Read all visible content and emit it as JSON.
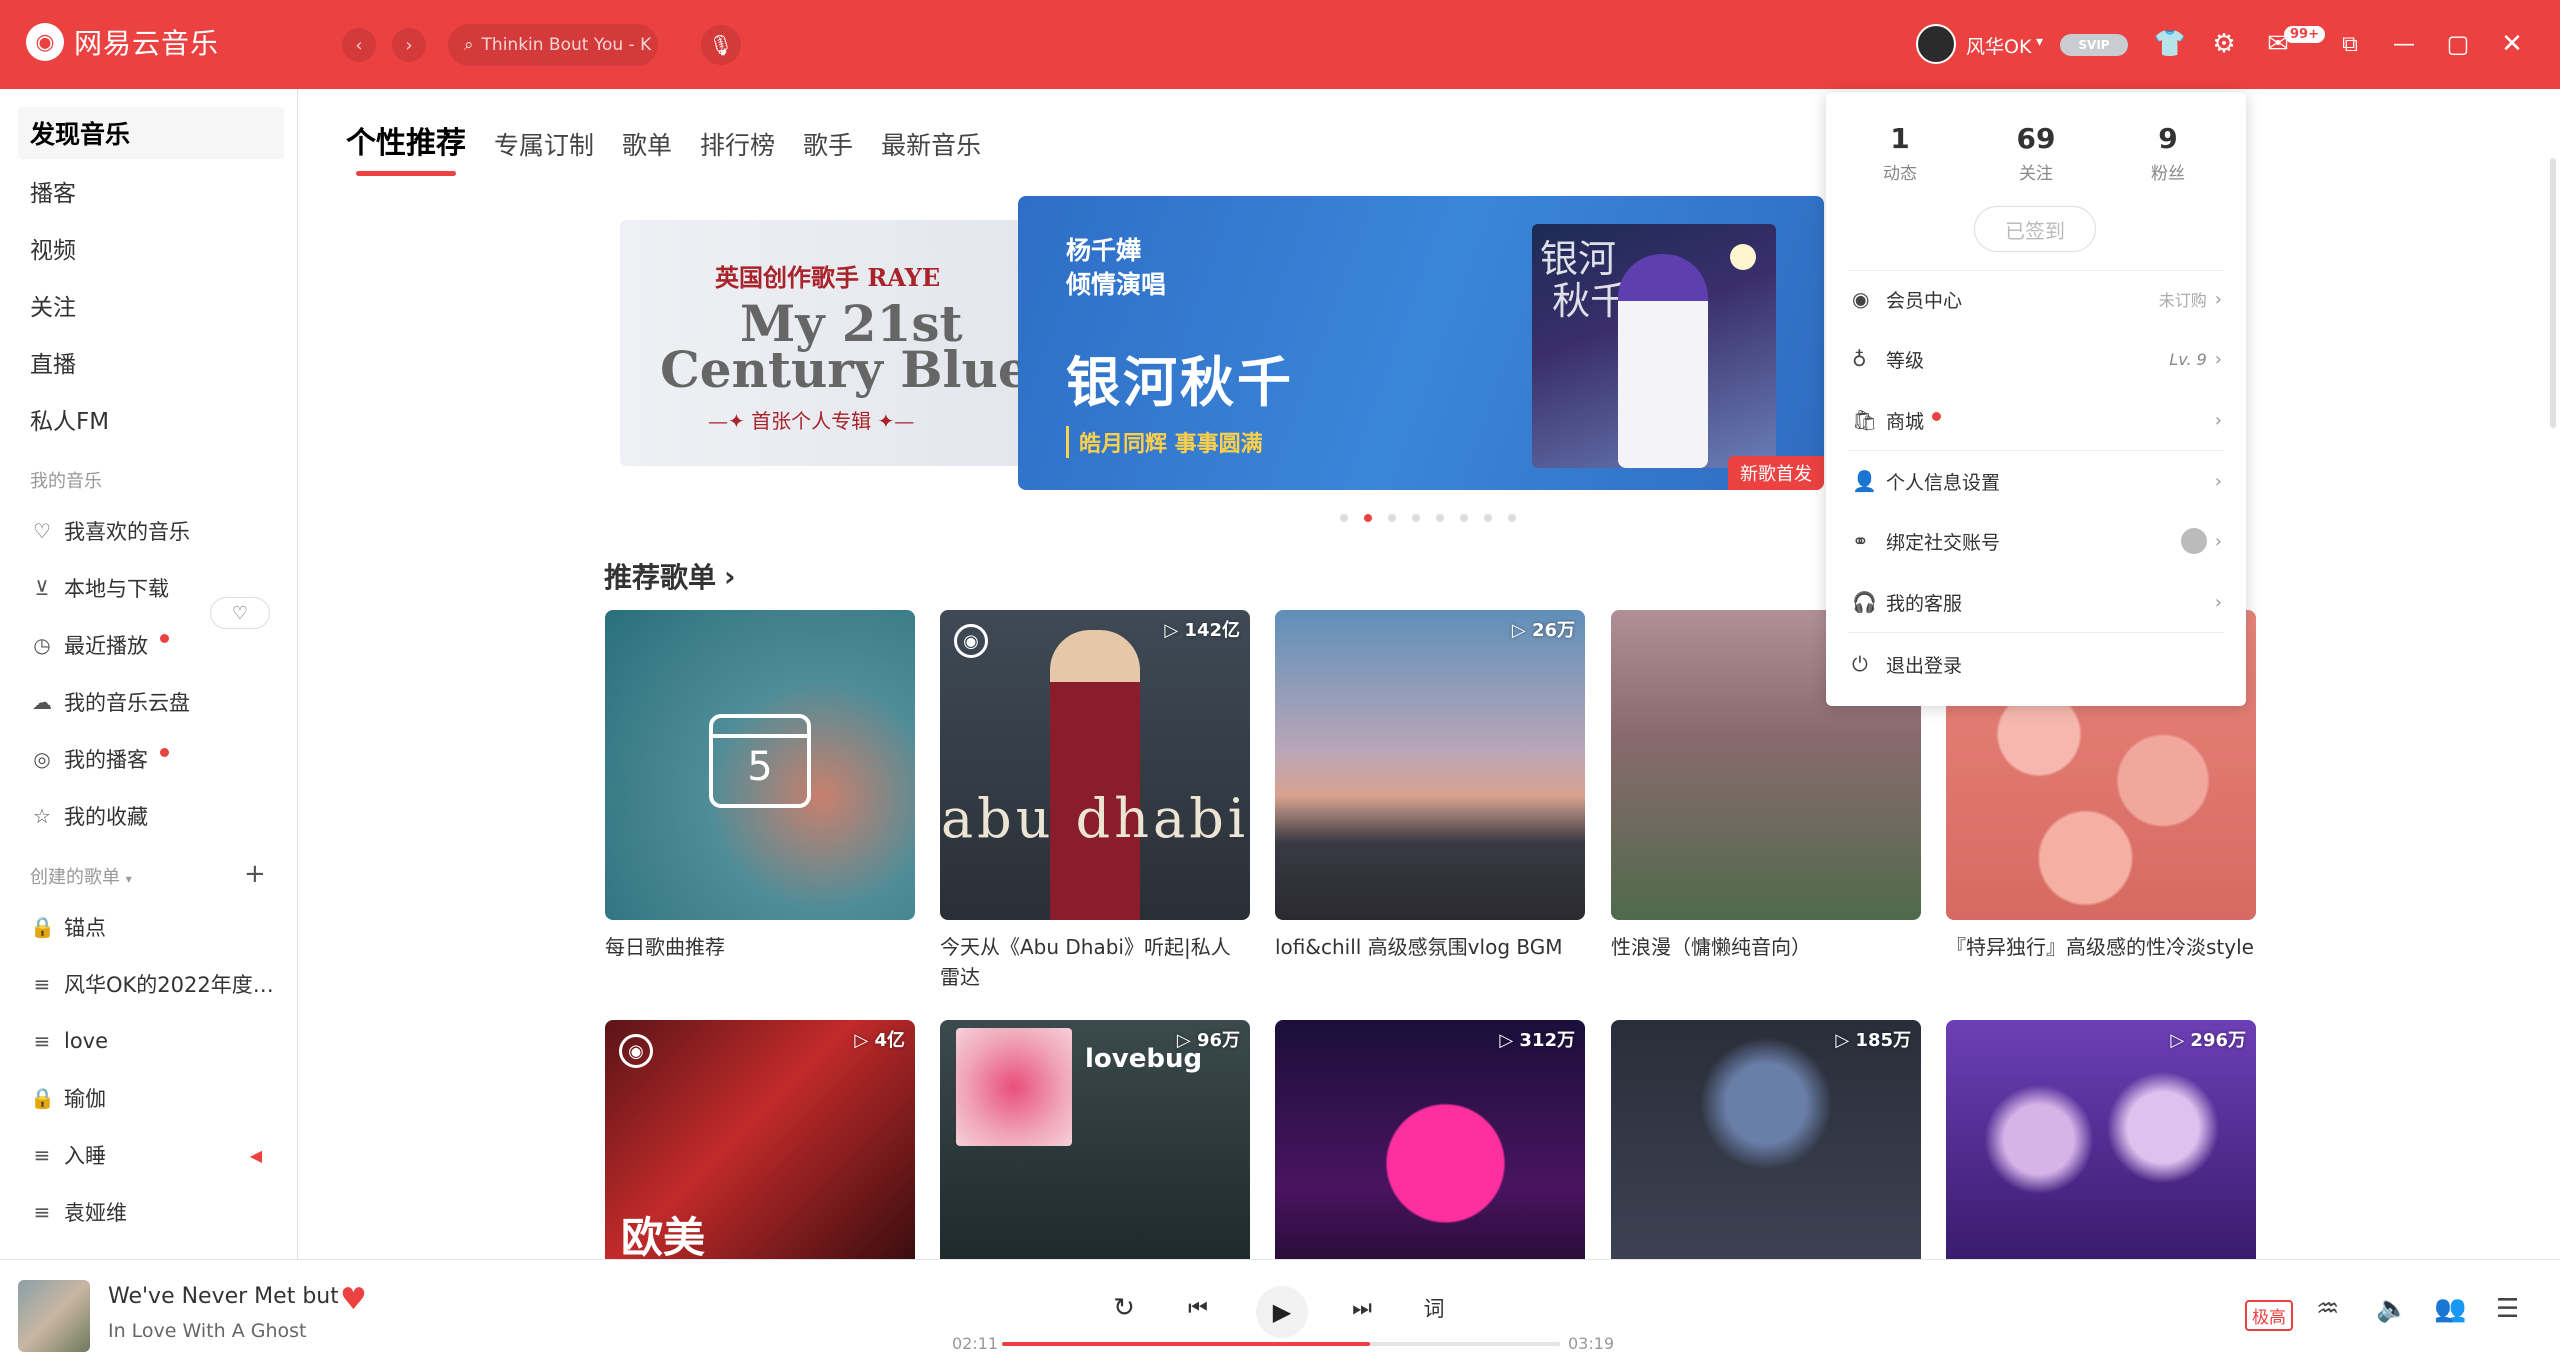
{
  "app": {
    "name": "网易云音乐"
  },
  "topbar": {
    "search_placeholder": "Thinkin Bout You - K",
    "username": "风华OK",
    "vip_label": "SVIP",
    "mail_badge": "99+"
  },
  "sidebar": {
    "main": [
      "发现音乐",
      "播客",
      "视频",
      "关注",
      "直播",
      "私人FM"
    ],
    "my_music_title": "我的音乐",
    "my_music": [
      "我喜欢的音乐",
      "本地与下载",
      "最近播放",
      "我的音乐云盘",
      "我的播客",
      "我的收藏"
    ],
    "created_title": "创建的歌单",
    "playlists": [
      "锚点",
      "风华OK的2022年度…",
      "love",
      "瑜伽",
      "入睡",
      "袁娅维"
    ]
  },
  "tabs": [
    "个性推荐",
    "专属订制",
    "歌单",
    "排行榜",
    "歌手",
    "最新音乐"
  ],
  "banner_left": {
    "subtitle": "英国创作歌手 RAYE",
    "title1": "My 21st",
    "title2": "Century Blues",
    "tagline": "首张个人专辑"
  },
  "banner_main": {
    "singer_line1": "杨千嬅",
    "singer_line2": "倾情演唱",
    "title": "银河秋千",
    "slogan": "皓月同辉 事事圆满",
    "cover_text": "银河秋千",
    "tag": "新歌首发"
  },
  "section_title": "推荐歌单",
  "playlists_row1": [
    {
      "title": "每日歌曲推荐",
      "count": "",
      "day": "5"
    },
    {
      "title": "今天从《Abu Dhabi》听起|私人雷达",
      "count": "142亿",
      "art": "abu dhabi"
    },
    {
      "title": "lofi&chill 高级感氛围vlog BGM",
      "count": "26万"
    },
    {
      "title": "性浪漫（慵懒纯音向）",
      "count": ""
    },
    {
      "title": "『特异独行』高级感的性冷淡style",
      "count": ""
    }
  ],
  "playlists_row2": [
    {
      "count": "4亿",
      "overlay": "欧美"
    },
    {
      "count": "96万",
      "art": "lovebug"
    },
    {
      "count": "312万"
    },
    {
      "count": "185万"
    },
    {
      "count": "296万"
    }
  ],
  "dropdown": {
    "stats": [
      {
        "num": "1",
        "label": "动态"
      },
      {
        "num": "69",
        "label": "关注"
      },
      {
        "num": "9",
        "label": "粉丝"
      }
    ],
    "signed": "已签到",
    "items": [
      {
        "label": "会员中心",
        "right": "未订购"
      },
      {
        "label": "等级",
        "right": "Lv. 9"
      },
      {
        "label": "商城",
        "right": ""
      },
      {
        "label": "个人信息设置",
        "right": ""
      },
      {
        "label": "绑定社交账号",
        "right": ""
      },
      {
        "label": "我的客服",
        "right": ""
      },
      {
        "label": "退出登录",
        "right": ""
      }
    ]
  },
  "player": {
    "title": "We've Never Met but C",
    "artist": "In Love With A Ghost",
    "time_current": "02:11",
    "time_total": "03:19",
    "progress": 0.66,
    "lyrics_label": "词",
    "quality": "极高"
  },
  "colors": {
    "accent": "#ec4141"
  }
}
